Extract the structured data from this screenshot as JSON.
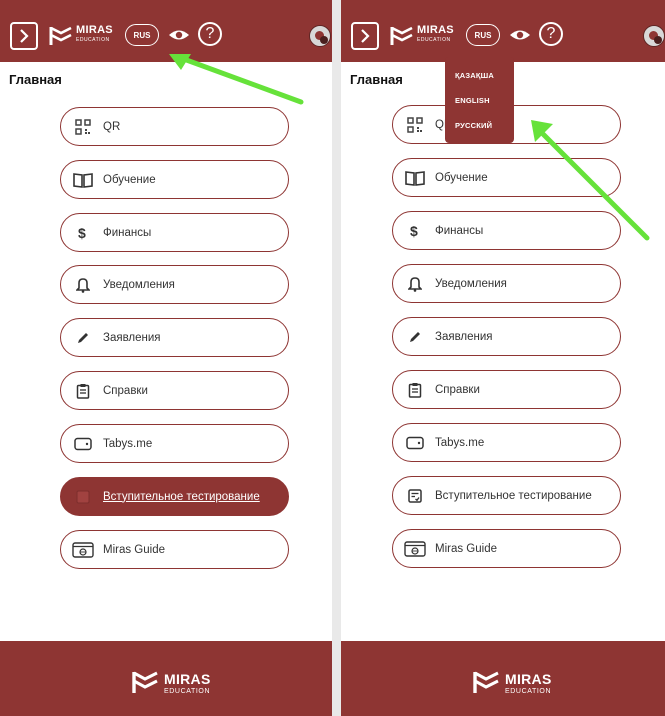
{
  "header": {
    "logo_text": "MIRAS",
    "logo_sub": "EDUCATION",
    "language_label": "RUS",
    "help_label": "?"
  },
  "page_title": "Главная",
  "menu": [
    {
      "label": "QR",
      "icon": "qr-code-icon"
    },
    {
      "label": "Обучение",
      "icon": "book-icon"
    },
    {
      "label": "Финансы",
      "icon": "dollar-icon"
    },
    {
      "label": "Уведомления",
      "icon": "bell-icon"
    },
    {
      "label": "Заявления",
      "icon": "pencil-icon"
    },
    {
      "label": "Справки",
      "icon": "clipboard-icon"
    },
    {
      "label": "Tabys.me",
      "icon": "wallet-icon"
    },
    {
      "label": "Вступительное тестирование",
      "icon": "test-form-icon"
    },
    {
      "label": "Miras Guide",
      "icon": "browser-guide-icon"
    }
  ],
  "language_dropdown": {
    "options": [
      "ҚАЗАҚША",
      "ENGLISH",
      "РУССКИЙ"
    ]
  },
  "footer": {
    "logo_text": "MIRAS",
    "logo_sub": "EDUCATION"
  },
  "colors": {
    "brand": "#8e3533",
    "annotation_arrow": "#66e23a"
  }
}
